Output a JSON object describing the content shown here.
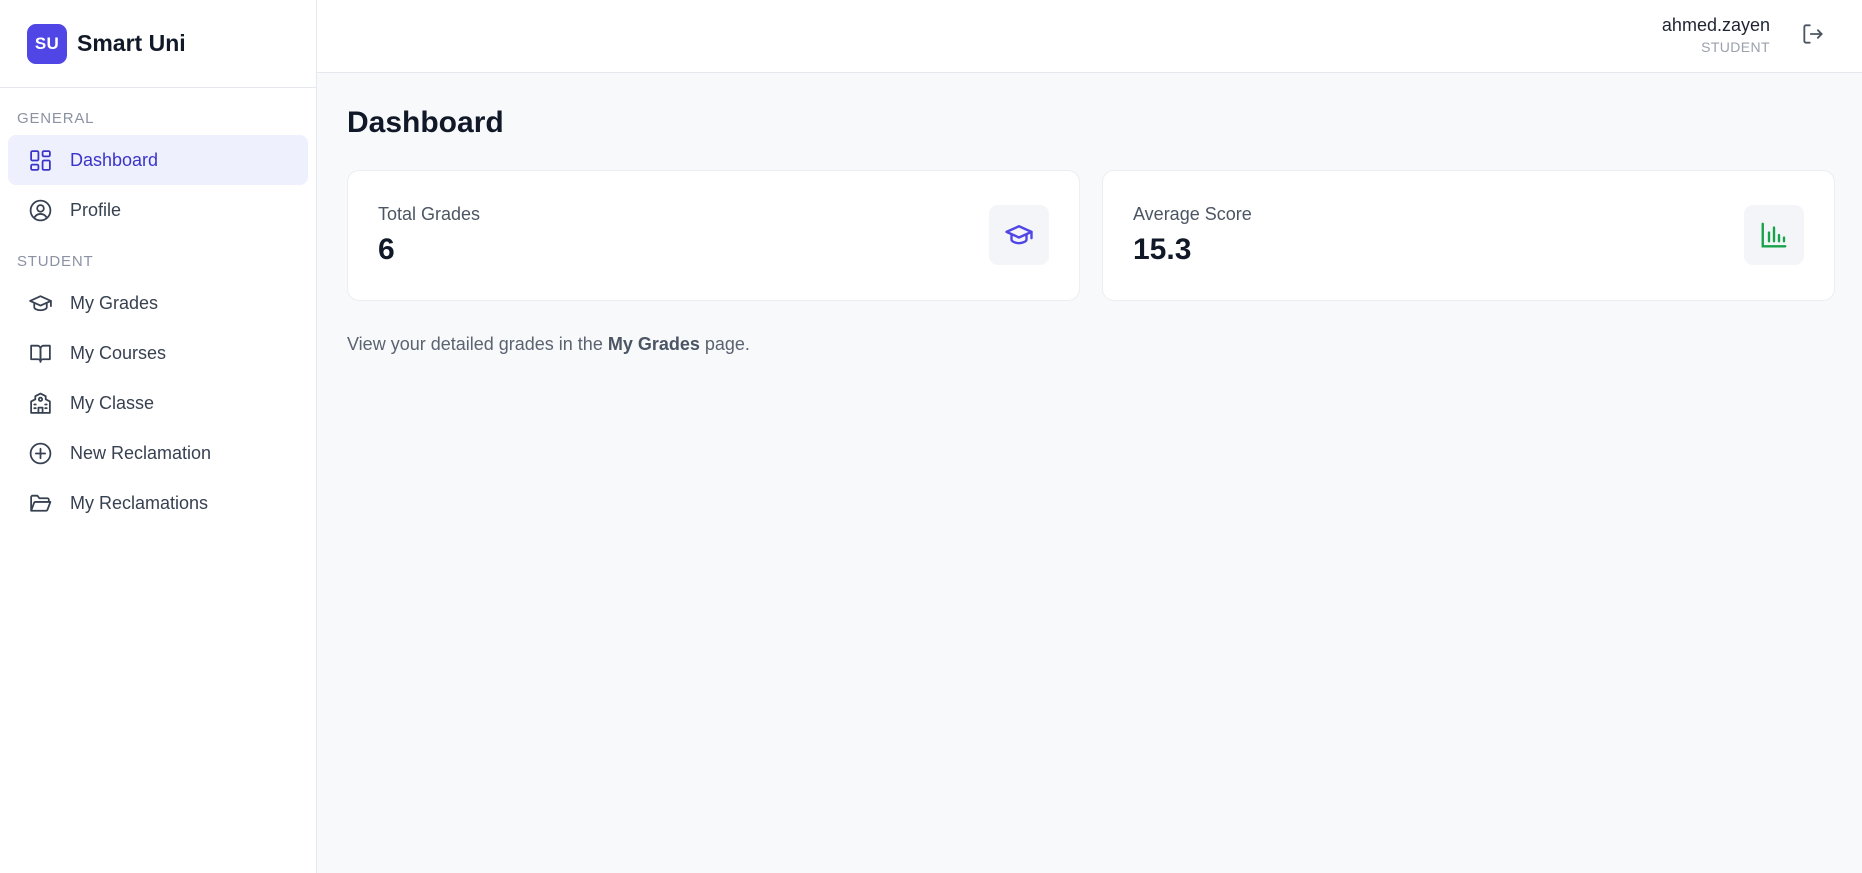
{
  "brand": {
    "logo_text": "SU",
    "name": "Smart Uni"
  },
  "sidebar": {
    "sections": [
      {
        "label": "GENERAL",
        "items": [
          {
            "label": "Dashboard",
            "icon": "dashboard-icon",
            "active": true
          },
          {
            "label": "Profile",
            "icon": "user-circle-icon",
            "active": false
          }
        ]
      },
      {
        "label": "STUDENT",
        "items": [
          {
            "label": "My Grades",
            "icon": "graduation-cap-icon",
            "active": false
          },
          {
            "label": "My Courses",
            "icon": "book-open-icon",
            "active": false
          },
          {
            "label": "My Classe",
            "icon": "school-icon",
            "active": false
          },
          {
            "label": "New Reclamation",
            "icon": "plus-circle-icon",
            "active": false
          },
          {
            "label": "My Reclamations",
            "icon": "folder-open-icon",
            "active": false
          }
        ]
      }
    ]
  },
  "topbar": {
    "user_name": "ahmed.zayen",
    "user_role": "STUDENT",
    "logout_icon": "logout-icon"
  },
  "main": {
    "title": "Dashboard",
    "cards": [
      {
        "label": "Total Grades",
        "value": "6",
        "icon": "graduation-cap-icon",
        "icon_color": "#4f46e5"
      },
      {
        "label": "Average Score",
        "value": "15.3",
        "icon": "bar-chart-icon",
        "icon_color": "#16a34a"
      }
    ],
    "info": {
      "prefix": "View your detailed grades in the ",
      "link": "My Grades",
      "suffix": " page."
    }
  },
  "colors": {
    "accent": "#4f46e5",
    "active_bg": "#eef0fd",
    "active_text": "#3b34c9",
    "success": "#16a34a"
  }
}
